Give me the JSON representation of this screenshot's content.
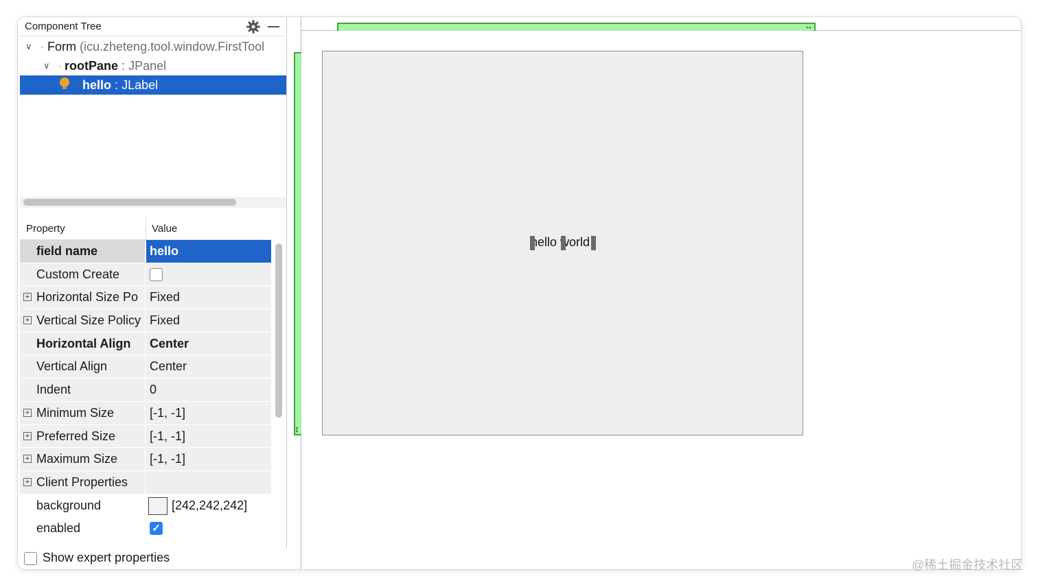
{
  "tree": {
    "title": "Component Tree",
    "nodes": [
      {
        "name": "Form",
        "type": "(icu.zheteng.tool.window.FirstTool"
      },
      {
        "name": "rootPane",
        "sep": ":",
        "type": "JPanel"
      },
      {
        "name": "hello",
        "sep": ":",
        "type": "JLabel"
      }
    ]
  },
  "properties": {
    "header": {
      "property": "Property",
      "value": "Value"
    },
    "rows": [
      {
        "name": "field name",
        "value": "hello"
      },
      {
        "name": "Custom Create",
        "value": ""
      },
      {
        "name": "Horizontal Size Po",
        "value": "Fixed"
      },
      {
        "name": "Vertical Size Policy",
        "value": "Fixed"
      },
      {
        "name": "Horizontal Align",
        "value": "Center"
      },
      {
        "name": "Vertical Align",
        "value": "Center"
      },
      {
        "name": "Indent",
        "value": "0"
      },
      {
        "name": "Minimum Size",
        "value": "[-1, -1]"
      },
      {
        "name": "Preferred Size",
        "value": "[-1, -1]"
      },
      {
        "name": "Maximum Size",
        "value": "[-1, -1]"
      },
      {
        "name": "Client Properties",
        "value": ""
      },
      {
        "name": "background",
        "value": "[242,242,242]"
      },
      {
        "name": "enabled",
        "value": ""
      }
    ],
    "show_expert_label": "Show expert properties",
    "checkmark": "✓",
    "expand_symbol": "+"
  },
  "designer": {
    "label_text": "hello world",
    "col_resize_glyph": "↔",
    "row_resize_glyph": "↕"
  },
  "watermark": "@稀土掘金技术社区",
  "colors": {
    "selection": "#1f64c8",
    "ruler_fill": "#a6f2a6",
    "ruler_border": "#3fa33f",
    "panel_background": "#eeeeee",
    "bulb": "#f0a020"
  }
}
